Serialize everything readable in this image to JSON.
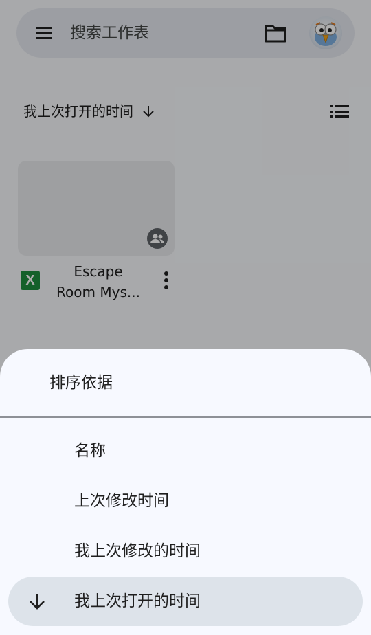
{
  "search": {
    "placeholder": "搜索工作表"
  },
  "sort": {
    "current_label": "我上次打开的时间"
  },
  "file": {
    "type_letter": "X",
    "name_line1": "Escape",
    "name_line2": "Room  Mys..."
  },
  "sheet": {
    "title": "排序依据",
    "options": [
      {
        "label": "名称"
      },
      {
        "label": "上次修改时间"
      },
      {
        "label": "我上次修改的时间"
      },
      {
        "label": "我上次打开的时间",
        "selected": true
      }
    ]
  },
  "colors": {
    "excel_green": "#1e8e3e",
    "selected_option_bg": "#dde3ea",
    "sheet_bg": "#f7f9ff"
  },
  "icons": [
    "menu-icon",
    "folder-icon",
    "avatar",
    "arrow-down-icon",
    "list-view-icon",
    "people-icon",
    "more-vert-icon"
  ]
}
